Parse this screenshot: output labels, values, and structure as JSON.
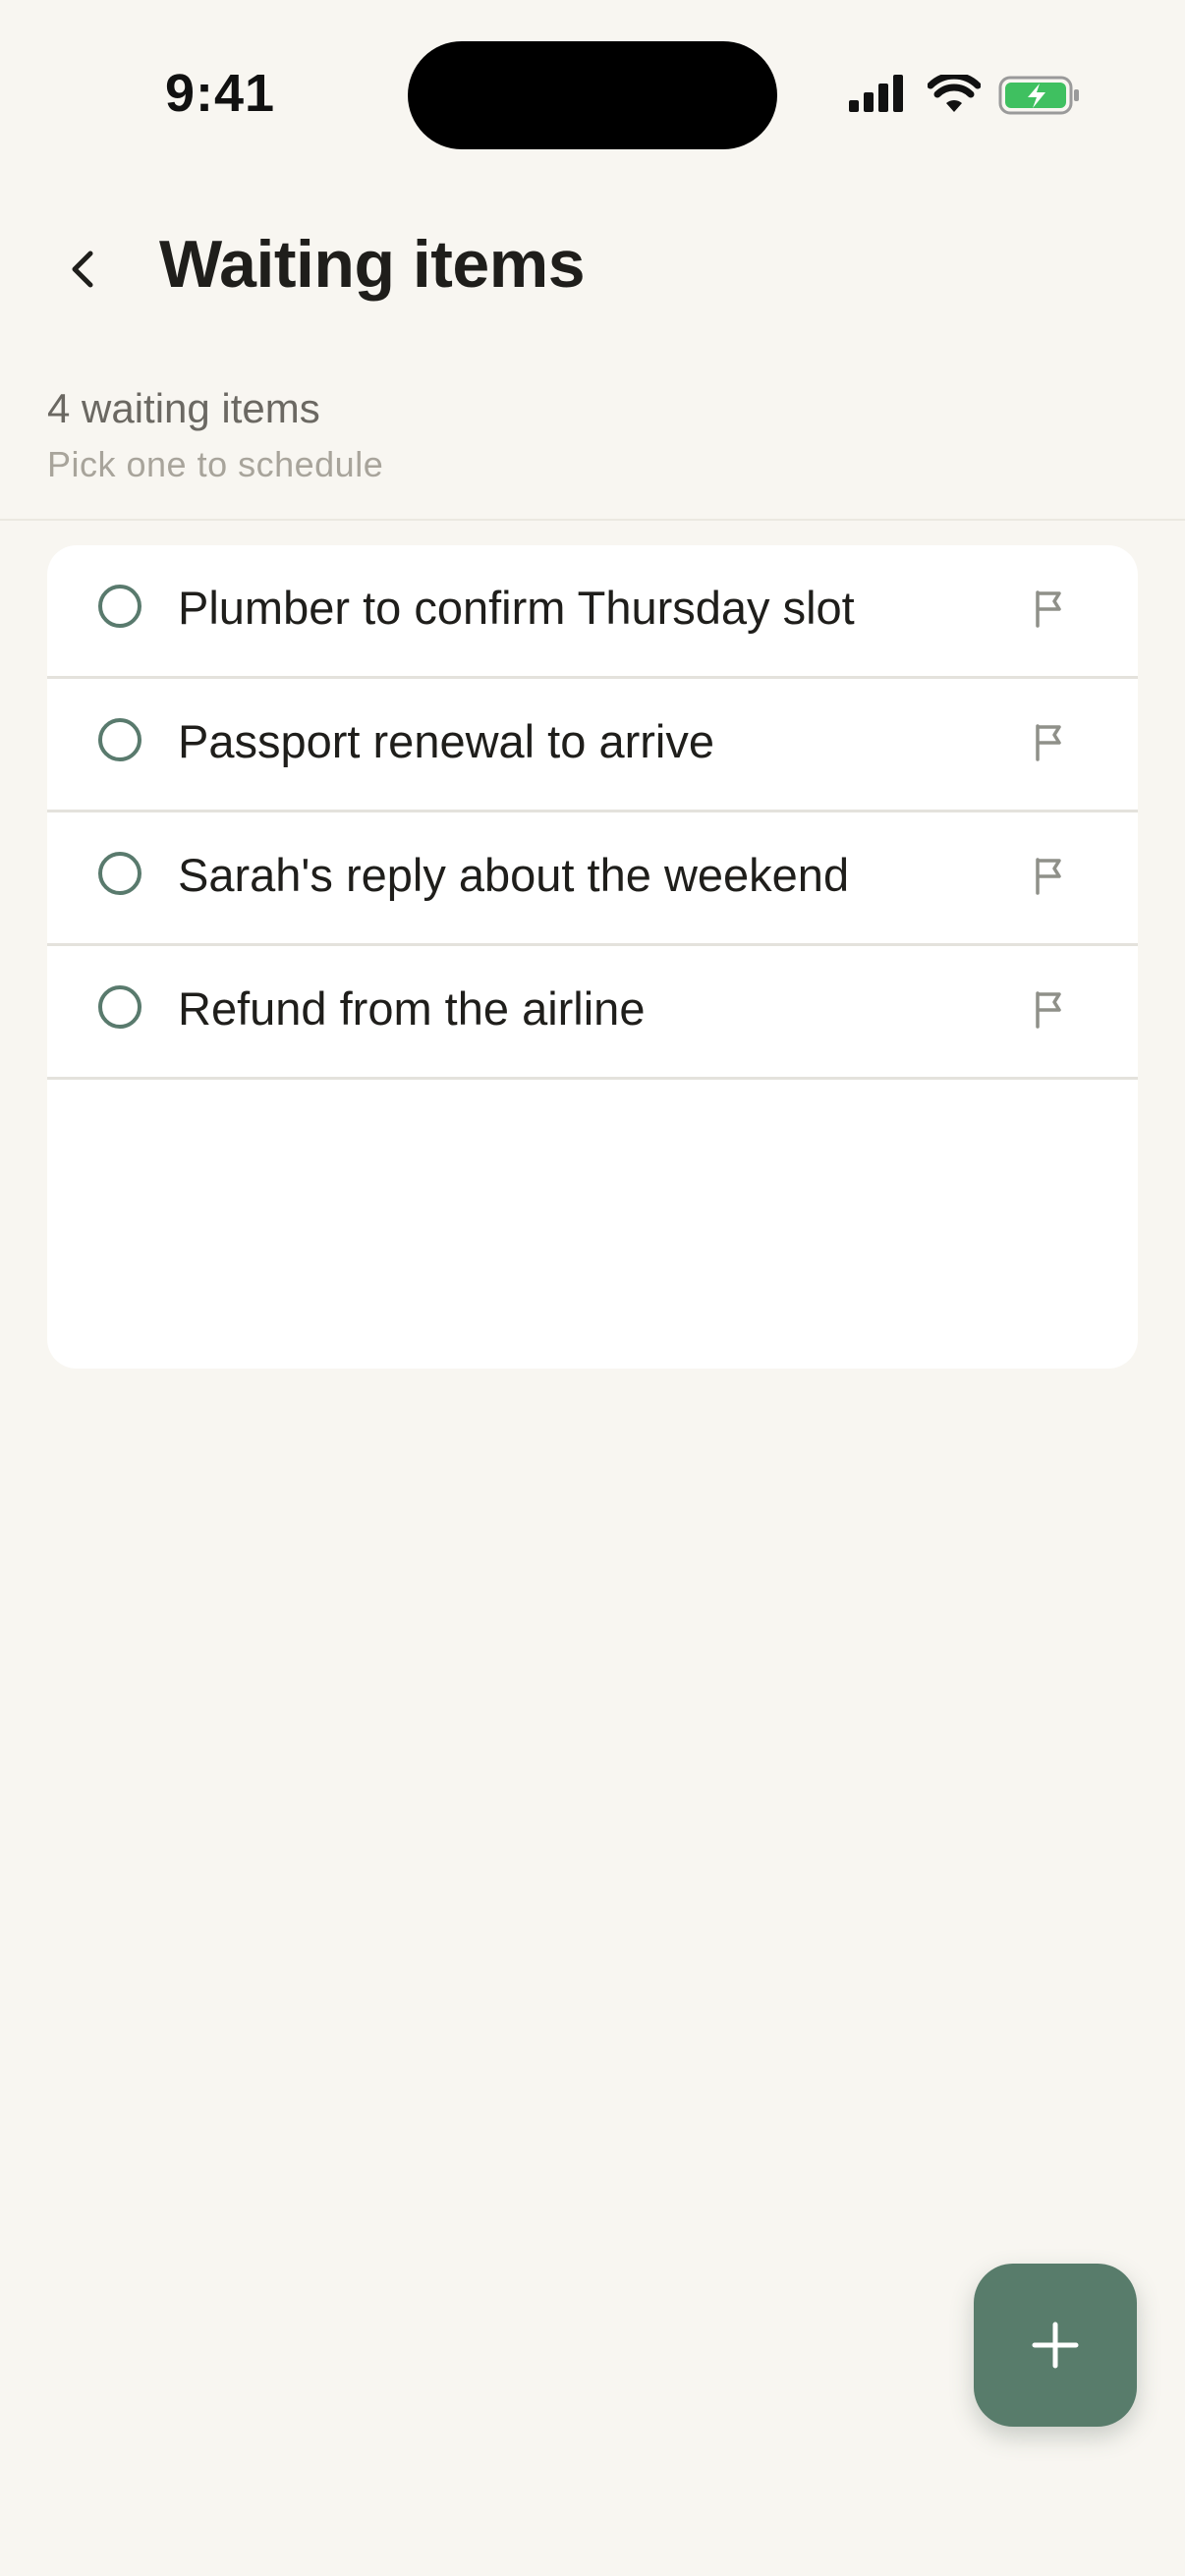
{
  "status_bar": {
    "time": "9:41",
    "icons": [
      "signal-icon",
      "wifi-icon",
      "battery-charging-icon"
    ],
    "battery_color": "#3fc060"
  },
  "header": {
    "back_icon": "chevron-left-icon",
    "title": "Waiting items"
  },
  "summary": {
    "count_text": "4 waiting items",
    "hint_text": "Pick one to schedule"
  },
  "list": {
    "items": [
      {
        "label": "Plumber to confirm Thursday slot",
        "icon": "flag-icon"
      },
      {
        "label": "Passport renewal to arrive",
        "icon": "flag-icon"
      },
      {
        "label": "Sarah's reply about the weekend",
        "icon": "flag-icon"
      },
      {
        "label": "Refund from the airline",
        "icon": "flag-icon"
      }
    ]
  },
  "fab": {
    "icon": "plus-icon",
    "color": "#587c6b"
  },
  "colors": {
    "background": "#f8f6f1",
    "card": "#ffffff",
    "accent": "#587c6b"
  }
}
